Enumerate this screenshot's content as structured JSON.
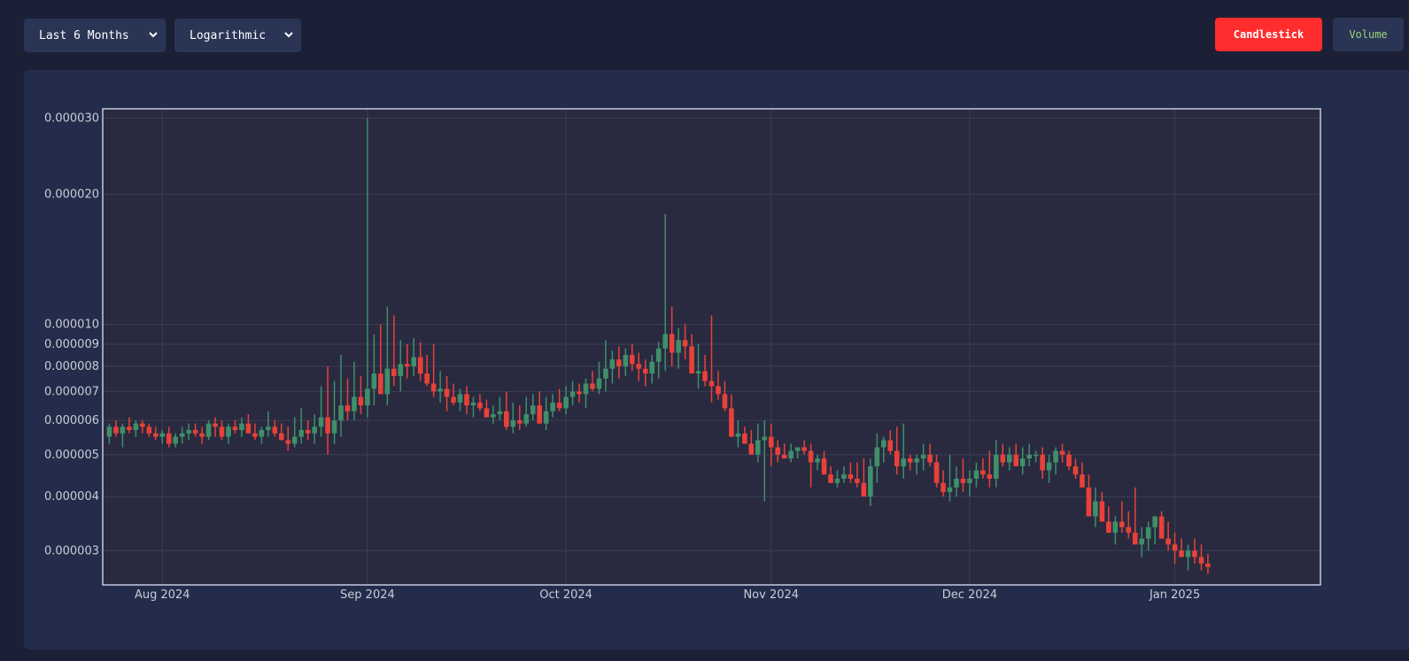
{
  "controls": {
    "range_select": {
      "value": "Last 6 Months",
      "icon": "chevron-down-icon"
    },
    "scale_select": {
      "value": "Logarithmic",
      "icon": "chevron-down-icon"
    },
    "candlestick_button": "Candlestick",
    "volume_button": "Volume"
  },
  "colors": {
    "up": "#3e8f6a",
    "down": "#e8413a",
    "plot_bg": "#292a3f",
    "panel_bg": "#232c4a",
    "page_bg": "#1b2036",
    "active_button": "#ff2d2d",
    "volume_text": "#9ed27a"
  },
  "chart_data": {
    "type": "candlestick",
    "y_scale": "log",
    "grid": true,
    "xlim": [
      "2024-07-23",
      "2025-01-23"
    ],
    "ylim": [
      2.5e-06,
      3.15e-05
    ],
    "x_ticks": [
      {
        "date": "2024-08-01",
        "label": "Aug 2024"
      },
      {
        "date": "2024-09-01",
        "label": "Sep 2024"
      },
      {
        "date": "2024-10-01",
        "label": "Oct 2024"
      },
      {
        "date": "2024-11-01",
        "label": "Nov 2024"
      },
      {
        "date": "2024-12-01",
        "label": "Dec 2024"
      },
      {
        "date": "2025-01-01",
        "label": "Jan 2025"
      }
    ],
    "y_ticks": [
      {
        "value": 3e-06,
        "label": "0.000003"
      },
      {
        "value": 4e-06,
        "label": "0.000004"
      },
      {
        "value": 5e-06,
        "label": "0.000005"
      },
      {
        "value": 6e-06,
        "label": "0.000006"
      },
      {
        "value": 7e-06,
        "label": "0.000007"
      },
      {
        "value": 8e-06,
        "label": "0.000008"
      },
      {
        "value": 9e-06,
        "label": "0.000009"
      },
      {
        "value": 1e-05,
        "label": "0.000010"
      },
      {
        "value": 2e-05,
        "label": "0.000020"
      },
      {
        "value": 3e-05,
        "label": "0.000030"
      }
    ],
    "start_date": "2024-07-24",
    "columns": [
      "open",
      "high",
      "low",
      "close"
    ],
    "ohlc": [
      [
        5.5,
        5.9,
        5.3,
        5.8
      ],
      [
        5.8,
        6.0,
        5.5,
        5.6
      ],
      [
        5.6,
        5.9,
        5.2,
        5.8
      ],
      [
        5.8,
        6.1,
        5.6,
        5.7
      ],
      [
        5.7,
        6.0,
        5.5,
        5.9
      ],
      [
        5.9,
        6.0,
        5.6,
        5.8
      ],
      [
        5.8,
        5.9,
        5.5,
        5.6
      ],
      [
        5.6,
        5.8,
        5.4,
        5.5
      ],
      [
        5.5,
        5.7,
        5.3,
        5.6
      ],
      [
        5.6,
        5.8,
        5.2,
        5.3
      ],
      [
        5.3,
        5.6,
        5.2,
        5.5
      ],
      [
        5.5,
        5.8,
        5.3,
        5.6
      ],
      [
        5.6,
        5.9,
        5.4,
        5.7
      ],
      [
        5.7,
        5.9,
        5.5,
        5.6
      ],
      [
        5.6,
        5.8,
        5.3,
        5.5
      ],
      [
        5.5,
        6.0,
        5.4,
        5.9
      ],
      [
        5.9,
        6.1,
        5.5,
        5.8
      ],
      [
        5.8,
        6.0,
        5.4,
        5.5
      ],
      [
        5.5,
        5.9,
        5.3,
        5.8
      ],
      [
        5.8,
        6.0,
        5.6,
        5.7
      ],
      [
        5.7,
        6.1,
        5.5,
        5.9
      ],
      [
        5.9,
        6.2,
        5.6,
        5.6
      ],
      [
        5.6,
        5.9,
        5.4,
        5.5
      ],
      [
        5.5,
        5.8,
        5.3,
        5.7
      ],
      [
        5.7,
        6.3,
        5.5,
        5.8
      ],
      [
        5.8,
        6.0,
        5.5,
        5.6
      ],
      [
        5.6,
        5.9,
        5.4,
        5.4
      ],
      [
        5.4,
        5.8,
        5.1,
        5.3
      ],
      [
        5.3,
        6.1,
        5.2,
        5.5
      ],
      [
        5.5,
        6.4,
        5.3,
        5.7
      ],
      [
        5.7,
        6.0,
        5.4,
        5.6
      ],
      [
        5.6,
        6.2,
        5.3,
        5.8
      ],
      [
        5.8,
        7.2,
        5.5,
        6.1
      ],
      [
        6.1,
        8.0,
        5.0,
        5.6
      ],
      [
        5.6,
        7.4,
        5.3,
        6.0
      ],
      [
        6.0,
        8.5,
        5.5,
        6.5
      ],
      [
        6.5,
        7.5,
        6.0,
        6.3
      ],
      [
        6.3,
        8.2,
        6.0,
        6.8
      ],
      [
        6.8,
        7.6,
        6.2,
        6.5
      ],
      [
        6.5,
        30.0,
        6.1,
        7.1
      ],
      [
        7.1,
        9.5,
        6.5,
        7.7
      ],
      [
        7.7,
        10.0,
        7.0,
        6.9
      ],
      [
        6.9,
        11.0,
        6.5,
        7.9
      ],
      [
        7.9,
        10.5,
        7.2,
        7.6
      ],
      [
        7.6,
        9.2,
        7.0,
        8.1
      ],
      [
        8.1,
        9.0,
        7.5,
        8.0
      ],
      [
        8.0,
        9.3,
        7.6,
        8.4
      ],
      [
        8.4,
        9.1,
        7.4,
        7.7
      ],
      [
        7.7,
        8.5,
        7.2,
        7.3
      ],
      [
        7.3,
        9.0,
        6.8,
        7.0
      ],
      [
        7.0,
        7.8,
        6.6,
        7.1
      ],
      [
        7.1,
        7.6,
        6.3,
        6.8
      ],
      [
        6.8,
        7.3,
        6.5,
        6.6
      ],
      [
        6.6,
        7.1,
        6.3,
        6.9
      ],
      [
        6.9,
        7.2,
        6.2,
        6.5
      ],
      [
        6.5,
        6.8,
        6.1,
        6.6
      ],
      [
        6.6,
        6.9,
        6.3,
        6.4
      ],
      [
        6.4,
        6.7,
        6.2,
        6.1
      ],
      [
        6.1,
        6.5,
        5.9,
        6.2
      ],
      [
        6.2,
        6.8,
        6.0,
        6.3
      ],
      [
        6.3,
        7.0,
        5.7,
        5.8
      ],
      [
        5.8,
        6.6,
        5.6,
        6.0
      ],
      [
        6.0,
        6.5,
        5.7,
        5.9
      ],
      [
        5.9,
        6.8,
        5.8,
        6.2
      ],
      [
        6.2,
        6.9,
        6.0,
        6.5
      ],
      [
        6.5,
        7.0,
        5.9,
        5.9
      ],
      [
        5.9,
        6.8,
        5.7,
        6.3
      ],
      [
        6.3,
        6.9,
        6.1,
        6.6
      ],
      [
        6.6,
        7.1,
        6.3,
        6.4
      ],
      [
        6.4,
        7.2,
        6.2,
        6.8
      ],
      [
        6.8,
        7.4,
        6.5,
        7.0
      ],
      [
        7.0,
        7.3,
        6.6,
        6.9
      ],
      [
        6.9,
        7.5,
        6.4,
        7.3
      ],
      [
        7.3,
        7.8,
        7.0,
        7.1
      ],
      [
        7.1,
        8.2,
        6.9,
        7.5
      ],
      [
        7.5,
        9.2,
        7.0,
        7.9
      ],
      [
        7.9,
        8.7,
        7.3,
        8.3
      ],
      [
        8.3,
        8.9,
        7.5,
        8.0
      ],
      [
        8.0,
        8.8,
        7.6,
        8.5
      ],
      [
        8.5,
        9.0,
        7.8,
        8.1
      ],
      [
        8.1,
        8.6,
        7.4,
        7.9
      ],
      [
        7.9,
        8.3,
        7.2,
        7.7
      ],
      [
        7.7,
        8.5,
        7.3,
        8.2
      ],
      [
        8.2,
        9.1,
        7.5,
        8.8
      ],
      [
        8.8,
        18.0,
        7.8,
        9.5
      ],
      [
        9.5,
        11.0,
        8.0,
        8.6
      ],
      [
        8.6,
        9.8,
        7.9,
        9.2
      ],
      [
        9.2,
        10.0,
        8.3,
        8.9
      ],
      [
        8.9,
        9.5,
        8.1,
        7.7
      ],
      [
        7.7,
        9.0,
        7.1,
        7.8
      ],
      [
        7.8,
        8.5,
        7.2,
        7.4
      ],
      [
        7.4,
        10.5,
        6.6,
        7.2
      ],
      [
        7.2,
        7.8,
        6.7,
        6.9
      ],
      [
        6.9,
        7.4,
        6.3,
        6.4
      ],
      [
        6.4,
        6.9,
        5.7,
        5.5
      ],
      [
        5.5,
        6.0,
        5.2,
        5.6
      ],
      [
        5.6,
        5.8,
        5.3,
        5.3
      ],
      [
        5.3,
        5.7,
        5.1,
        5.0
      ],
      [
        5.0,
        5.9,
        4.8,
        5.4
      ],
      [
        5.4,
        6.0,
        3.9,
        5.5
      ],
      [
        5.5,
        5.9,
        4.7,
        5.2
      ],
      [
        5.2,
        5.4,
        4.8,
        5.0
      ],
      [
        5.0,
        5.3,
        4.9,
        4.9
      ],
      [
        4.9,
        5.3,
        4.8,
        5.1
      ],
      [
        5.1,
        5.2,
        4.9,
        5.2
      ],
      [
        5.2,
        5.4,
        5.0,
        5.1
      ],
      [
        5.1,
        5.3,
        4.2,
        4.8
      ],
      [
        4.8,
        5.0,
        4.6,
        4.9
      ],
      [
        4.9,
        5.1,
        4.7,
        4.5
      ],
      [
        4.5,
        4.7,
        4.3,
        4.3
      ],
      [
        4.3,
        4.6,
        4.2,
        4.4
      ],
      [
        4.4,
        4.7,
        4.3,
        4.5
      ],
      [
        4.5,
        4.8,
        4.3,
        4.4
      ],
      [
        4.4,
        4.8,
        4.2,
        4.3
      ],
      [
        4.3,
        4.9,
        4.1,
        4.0
      ],
      [
        4.0,
        4.9,
        3.8,
        4.7
      ],
      [
        4.7,
        5.6,
        4.3,
        5.2
      ],
      [
        5.2,
        5.5,
        4.8,
        5.4
      ],
      [
        5.4,
        5.7,
        5.0,
        5.1
      ],
      [
        5.1,
        5.8,
        4.5,
        4.7
      ],
      [
        4.7,
        5.9,
        4.4,
        4.9
      ],
      [
        4.9,
        5.0,
        4.6,
        4.8
      ],
      [
        4.8,
        5.0,
        4.5,
        4.9
      ],
      [
        4.9,
        5.3,
        4.6,
        5.0
      ],
      [
        5.0,
        5.3,
        4.7,
        4.8
      ],
      [
        4.8,
        5.0,
        4.2,
        4.3
      ],
      [
        4.3,
        4.6,
        4.0,
        4.1
      ],
      [
        4.1,
        5.0,
        3.9,
        4.2
      ],
      [
        4.2,
        4.7,
        4.0,
        4.4
      ],
      [
        4.4,
        4.9,
        4.1,
        4.3
      ],
      [
        4.3,
        4.6,
        4.0,
        4.4
      ],
      [
        4.4,
        4.8,
        4.2,
        4.6
      ],
      [
        4.6,
        4.9,
        4.4,
        4.5
      ],
      [
        4.5,
        5.1,
        4.2,
        4.4
      ],
      [
        4.4,
        5.4,
        4.2,
        5.0
      ],
      [
        5.0,
        5.3,
        4.7,
        4.8
      ],
      [
        4.8,
        5.2,
        4.6,
        5.0
      ],
      [
        5.0,
        5.3,
        4.8,
        4.7
      ],
      [
        4.7,
        5.2,
        4.5,
        4.9
      ],
      [
        4.9,
        5.3,
        4.7,
        5.0
      ],
      [
        5.0,
        5.1,
        4.8,
        5.0
      ],
      [
        5.0,
        5.2,
        4.4,
        4.6
      ],
      [
        4.6,
        5.0,
        4.3,
        4.8
      ],
      [
        4.8,
        5.2,
        4.5,
        5.1
      ],
      [
        5.1,
        5.3,
        4.8,
        5.0
      ],
      [
        5.0,
        5.1,
        4.6,
        4.7
      ],
      [
        4.7,
        4.9,
        4.4,
        4.5
      ],
      [
        4.5,
        4.8,
        4.2,
        4.2
      ],
      [
        4.2,
        4.5,
        3.9,
        3.6
      ],
      [
        3.6,
        4.2,
        3.4,
        3.9
      ],
      [
        3.9,
        4.1,
        3.6,
        3.5
      ],
      [
        3.5,
        3.8,
        3.3,
        3.3
      ],
      [
        3.3,
        3.6,
        3.1,
        3.5
      ],
      [
        3.5,
        3.9,
        3.3,
        3.4
      ],
      [
        3.4,
        3.7,
        3.2,
        3.3
      ],
      [
        3.3,
        4.2,
        3.1,
        3.1
      ],
      [
        3.1,
        3.4,
        2.9,
        3.2
      ],
      [
        3.2,
        3.5,
        3.0,
        3.4
      ],
      [
        3.4,
        3.6,
        3.1,
        3.6
      ],
      [
        3.6,
        3.7,
        3.2,
        3.2
      ],
      [
        3.2,
        3.5,
        3.0,
        3.1
      ],
      [
        3.1,
        3.3,
        2.8,
        3.0
      ],
      [
        3.0,
        3.2,
        2.9,
        2.9
      ],
      [
        2.9,
        3.1,
        2.7,
        3.0
      ],
      [
        3.0,
        3.2,
        2.8,
        2.9
      ],
      [
        2.9,
        3.1,
        2.7,
        2.8
      ],
      [
        2.8,
        2.95,
        2.65,
        2.75
      ]
    ]
  }
}
